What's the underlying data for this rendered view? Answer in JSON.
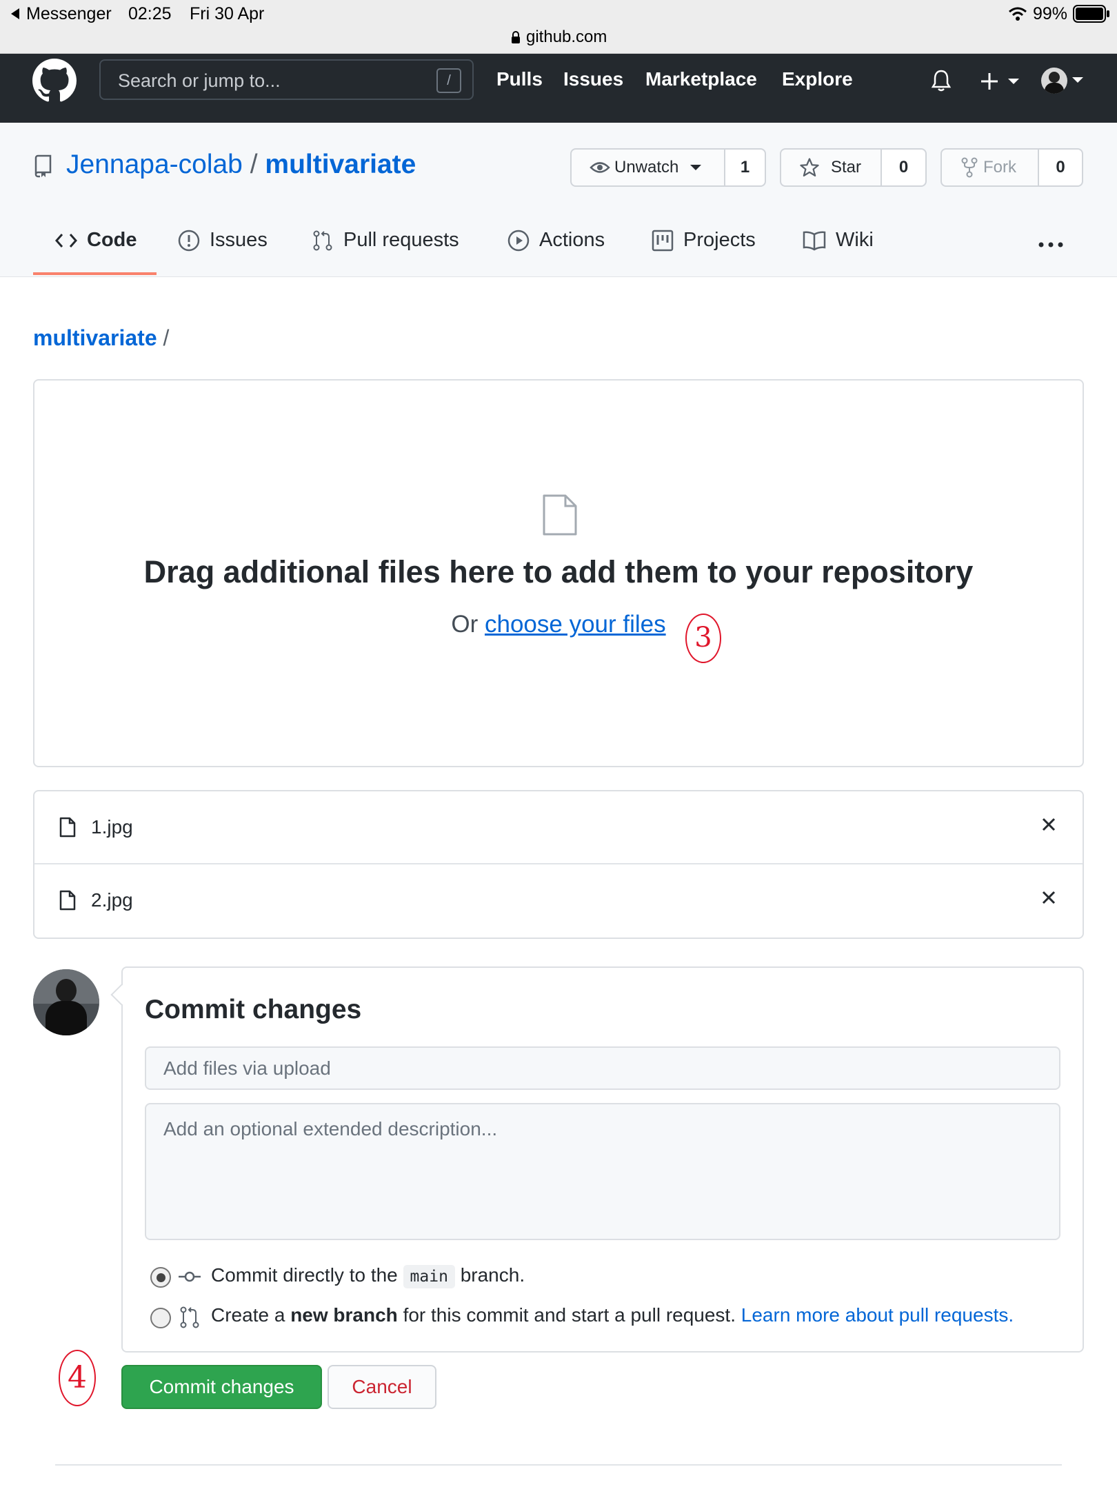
{
  "status_bar": {
    "back_app": "Messenger",
    "time": "02:25",
    "date": "Fri 30 Apr",
    "battery": "99%",
    "url": "github.com"
  },
  "header": {
    "search_placeholder": "Search or jump to...",
    "search_shortcut": "/",
    "nav": [
      "Pulls",
      "Issues",
      "Marketplace",
      "Explore"
    ]
  },
  "repo": {
    "owner": "Jennapa-colab",
    "separator": "/",
    "name": "multivariate",
    "unwatch_label": "Unwatch",
    "watch_count": "1",
    "star_label": "Star",
    "star_count": "0",
    "fork_label": "Fork",
    "fork_count": "0"
  },
  "tabs": [
    {
      "label": "Code",
      "icon": "code-icon",
      "selected": true
    },
    {
      "label": "Issues",
      "icon": "issue-icon"
    },
    {
      "label": "Pull requests",
      "icon": "pull-request-icon"
    },
    {
      "label": "Actions",
      "icon": "play-icon"
    },
    {
      "label": "Projects",
      "icon": "project-icon"
    },
    {
      "label": "Wiki",
      "icon": "book-icon"
    }
  ],
  "breadcrumb": {
    "repo": "multivariate",
    "separator": "/"
  },
  "dropzone": {
    "title": "Drag additional files here to add them to your repository",
    "or_text": "Or",
    "choose_link": "choose your files",
    "annotation": "3"
  },
  "files": [
    {
      "name": "1.jpg"
    },
    {
      "name": "2.jpg"
    }
  ],
  "commit": {
    "heading": "Commit changes",
    "summary_placeholder": "Add files via upload",
    "description_placeholder": "Add an optional extended description...",
    "option_direct_prefix": "Commit directly to the",
    "branch": "main",
    "option_direct_suffix": "branch.",
    "option_new_prefix": "Create a",
    "option_new_bold": "new branch",
    "option_new_suffix": "for this commit and start a pull request.",
    "learn_more": "Learn more about pull requests.",
    "selected_option": "direct",
    "submit_label": "Commit changes",
    "cancel_label": "Cancel",
    "annotation": "4"
  },
  "colors": {
    "header_bg": "#24292e",
    "link": "#0366d6",
    "primary_button": "#2ea44f",
    "cancel_text": "#cb2431",
    "tab_underline": "#f9826c",
    "annotation": "#e0162b"
  }
}
